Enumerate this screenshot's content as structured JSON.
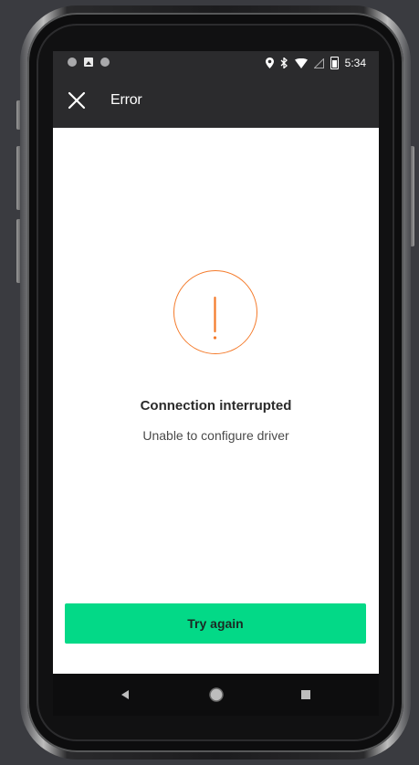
{
  "status_bar": {
    "time": "5:34",
    "left_icons": [
      "circle-notification-icon",
      "image-notification-icon",
      "circle-notification-icon"
    ],
    "right_icons": [
      "location-icon",
      "bluetooth-icon",
      "wifi-icon",
      "signal-icon",
      "battery-icon"
    ]
  },
  "app_bar": {
    "title": "Error",
    "close_icon": "close-icon"
  },
  "alert": {
    "icon": "exclamation-circle-icon",
    "accent_color": "#f47a2a",
    "title": "Connection interrupted",
    "message": "Unable to configure driver"
  },
  "actions": {
    "retry_label": "Try again",
    "retry_color": "#03d987"
  },
  "nav_bar": {
    "back_icon": "back-triangle-icon",
    "home_icon": "home-circle-icon",
    "recent_icon": "recent-square-icon"
  }
}
